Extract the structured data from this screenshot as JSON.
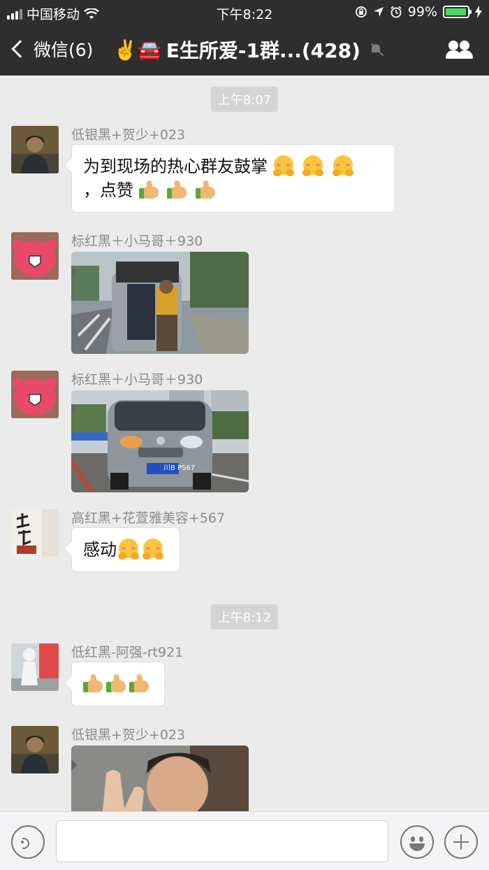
{
  "status_bar": {
    "carrier": "中国移动",
    "time": "下午8:22",
    "battery": "99%",
    "battery_level": 0.99
  },
  "nav": {
    "back_label": "微信(6)",
    "title_emoji": "✌️🚘",
    "title": "E生所爱-1群...(428)",
    "icons": [
      "back-chevron-icon",
      "mute-icon",
      "group-members-icon"
    ]
  },
  "chat": {
    "timestamps": [
      "上午8:07",
      "上午8:12"
    ],
    "messages": [
      {
        "sender": "低银黑+贺少+023",
        "type": "text",
        "line1": "为到现场的热心群友鼓掌",
        "line2": "，点赞"
      },
      {
        "sender": "标红黑＋小马哥＋930",
        "type": "image"
      },
      {
        "sender": "标红黑＋小马哥＋930",
        "type": "image",
        "plate_text": "川B PS671"
      },
      {
        "sender": "高红黑+花萱雅美容+567",
        "type": "text",
        "text": "感动"
      },
      {
        "sender": "低红黑-阿强-rt921",
        "type": "emoji"
      },
      {
        "sender": "低银黑+贺少+023",
        "type": "image"
      }
    ]
  },
  "input_bar": {
    "placeholder": "",
    "icons": [
      "voice-icon",
      "emoji-icon",
      "plus-icon"
    ]
  },
  "colors": {
    "header_bg": "#2e2e2e",
    "chat_bg": "#ebebeb",
    "battery_green": "#4cd964"
  }
}
